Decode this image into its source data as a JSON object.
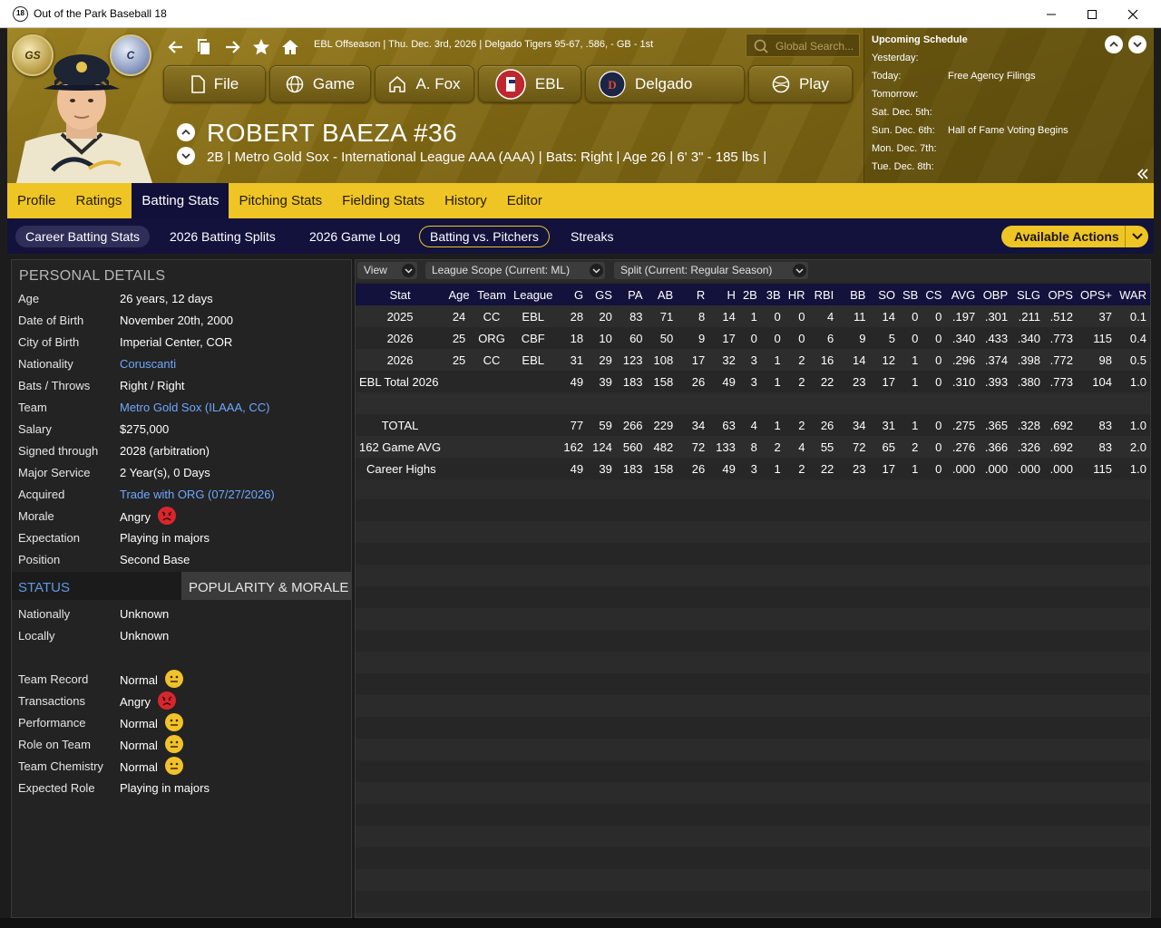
{
  "window": {
    "title": "Out of the Park Baseball 18",
    "app_icon_text": "18"
  },
  "header": {
    "context": "EBL Offseason  |  Thu. Dec. 3rd, 2026  |  Delgado Tigers  95-67, .586, - GB - 1st",
    "search_placeholder": "Global Search...",
    "logo_left_text": "GS",
    "logo_right_text": "C",
    "buttons": {
      "file": "File",
      "game": "Game",
      "manager": "A. Fox",
      "league": "EBL",
      "team": "Delgado",
      "play": "Play"
    }
  },
  "player": {
    "name": "ROBERT BAEZA  #36",
    "info": "2B | Metro Gold Sox - International League AAA (AAA)  |  Bats: Right  |  Age 26  |  6' 3\" - 185 lbs  |"
  },
  "schedule": {
    "title": "Upcoming Schedule",
    "rows": [
      {
        "day": "Yesterday:",
        "event": ""
      },
      {
        "day": "Today:",
        "event": "Free Agency Filings"
      },
      {
        "day": "Tomorrow:",
        "event": ""
      },
      {
        "day": "Sat. Dec. 5th:",
        "event": ""
      },
      {
        "day": "Sun. Dec. 6th:",
        "event": "Hall of Fame Voting Begins"
      },
      {
        "day": "Mon. Dec. 7th:",
        "event": ""
      },
      {
        "day": "Tue. Dec. 8th:",
        "event": ""
      }
    ]
  },
  "tabs": [
    "Profile",
    "Ratings",
    "Batting Stats",
    "Pitching Stats",
    "Fielding Stats",
    "History",
    "Editor"
  ],
  "subtabs": [
    "Career Batting Stats",
    "2026 Batting Splits",
    "2026 Game Log",
    "Batting vs. Pitchers",
    "Streaks"
  ],
  "available_actions": "Available Actions",
  "personal": {
    "title": "PERSONAL DETAILS",
    "rows": [
      {
        "label": "Age",
        "value": "26 years, 12 days"
      },
      {
        "label": "Date of Birth",
        "value": "November 20th, 2000"
      },
      {
        "label": "City of Birth",
        "value": "Imperial Center, COR"
      },
      {
        "label": "Nationality",
        "value": "Coruscanti"
      },
      {
        "label": "Bats / Throws",
        "value": "Right / Right"
      },
      {
        "label": "Team",
        "value": "Metro Gold Sox (ILAAA, CC)"
      },
      {
        "label": "Salary",
        "value": "$275,000"
      },
      {
        "label": "Signed through",
        "value": "2028 (arbitration)"
      },
      {
        "label": "Major Service",
        "value": "2 Year(s), 0 Days"
      },
      {
        "label": "Acquired",
        "value": "Trade with ORG (07/27/2026)"
      },
      {
        "label": "Morale",
        "value": "Angry"
      },
      {
        "label": "Expectation",
        "value": "Playing in majors"
      },
      {
        "label": "Position",
        "value": "Second Base"
      }
    ]
  },
  "status": {
    "tab_status": "STATUS",
    "tab_popularity": "POPULARITY & MORALE",
    "rows": [
      {
        "label": "Nationally",
        "value": "Unknown"
      },
      {
        "label": "Locally",
        "value": "Unknown"
      },
      {
        "label": "Team Record",
        "value": "Normal"
      },
      {
        "label": "Transactions",
        "value": "Angry"
      },
      {
        "label": "Performance",
        "value": "Normal"
      },
      {
        "label": "Role on Team",
        "value": "Normal"
      },
      {
        "label": "Team Chemistry",
        "value": "Normal"
      },
      {
        "label": "Expected Role",
        "value": "Playing in majors"
      }
    ]
  },
  "filters": {
    "view": "View",
    "scope": "League Scope  (Current: ML)",
    "split": "Split  (Current: Regular Season)"
  },
  "stats": {
    "headers": [
      "Stat",
      "Age",
      "Team",
      "League",
      "G",
      "GS",
      "PA",
      "AB",
      "R",
      "H",
      "2B",
      "3B",
      "HR",
      "RBI",
      "BB",
      "SO",
      "SB",
      "CS",
      "AVG",
      "OBP",
      "SLG",
      "OPS",
      "OPS+",
      "WAR"
    ],
    "rows": [
      [
        "2025",
        "24",
        "CC",
        "EBL",
        "28",
        "20",
        "83",
        "71",
        "8",
        "14",
        "1",
        "0",
        "0",
        "4",
        "11",
        "14",
        "0",
        "0",
        ".197",
        ".301",
        ".211",
        ".512",
        "37",
        "0.1"
      ],
      [
        "2026",
        "25",
        "ORG",
        "CBF",
        "18",
        "10",
        "60",
        "50",
        "9",
        "17",
        "0",
        "0",
        "0",
        "6",
        "9",
        "5",
        "0",
        "0",
        ".340",
        ".433",
        ".340",
        ".773",
        "115",
        "0.4"
      ],
      [
        "2026",
        "25",
        "CC",
        "EBL",
        "31",
        "29",
        "123",
        "108",
        "17",
        "32",
        "3",
        "1",
        "2",
        "16",
        "14",
        "12",
        "1",
        "0",
        ".296",
        ".374",
        ".398",
        ".772",
        "98",
        "0.5"
      ],
      [
        "EBL Total 2026",
        "",
        "",
        "",
        "49",
        "39",
        "183",
        "158",
        "26",
        "49",
        "3",
        "1",
        "2",
        "22",
        "23",
        "17",
        "1",
        "0",
        ".310",
        ".393",
        ".380",
        ".773",
        "104",
        "1.0"
      ],
      [
        "",
        "",
        "",
        "",
        "",
        "",
        "",
        "",
        "",
        "",
        "",
        "",
        "",
        "",
        "",
        "",
        "",
        "",
        "",
        "",
        "",
        "",
        "",
        ""
      ],
      [
        "TOTAL",
        "",
        "",
        "",
        "77",
        "59",
        "266",
        "229",
        "34",
        "63",
        "4",
        "1",
        "2",
        "26",
        "34",
        "31",
        "1",
        "0",
        ".275",
        ".365",
        ".328",
        ".692",
        "83",
        "1.0"
      ],
      [
        "162 Game AVG",
        "",
        "",
        "",
        "162",
        "124",
        "560",
        "482",
        "72",
        "133",
        "8",
        "2",
        "4",
        "55",
        "72",
        "65",
        "2",
        "0",
        ".276",
        ".366",
        ".326",
        ".692",
        "83",
        "2.0"
      ],
      [
        "Career Highs",
        "",
        "",
        "",
        "49",
        "39",
        "183",
        "158",
        "26",
        "49",
        "3",
        "1",
        "2",
        "22",
        "23",
        "17",
        "1",
        "0",
        ".000",
        ".000",
        ".000",
        ".000",
        "115",
        "1.0"
      ]
    ]
  },
  "colors": {
    "accent_yellow": "#eec524",
    "navy": "#12123d",
    "link_blue": "#6ea8ff",
    "angry_red": "#d9262d",
    "neutral_yellow": "#f2c22a"
  }
}
